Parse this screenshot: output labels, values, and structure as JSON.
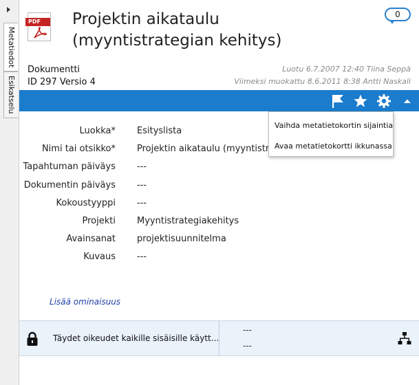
{
  "side_tabs": [
    "Metatiedot",
    "Esikatselu"
  ],
  "header": {
    "file_type": "PDF",
    "title": "Projektin aikataulu (myyntistrategian kehitys)",
    "comment_count": "0",
    "object_type": "Dokumentti",
    "object_id": "ID 297  Versio 4",
    "created": "Luotu 6.7.2007 12:40 Tiina Seppä",
    "modified": "Viimeksi muokattu 8.6.2011 8:38 Antti Naskali"
  },
  "toolbar": {
    "accent": "#1b7ccd",
    "icons": [
      "flag-icon",
      "star-icon",
      "gear-icon",
      "collapse-up-icon"
    ]
  },
  "dropdown": {
    "items": [
      "Vaihda metatietokortin sijaintia",
      "Avaa metatietokortti ikkunassa"
    ]
  },
  "properties": [
    {
      "label": "Luokka*",
      "value": "Esityslista"
    },
    {
      "label": "Nimi tai otsikko*",
      "value": "Projektin aikataulu (myyntistrateg"
    },
    {
      "label": "Tapahtuman päiväys",
      "value": "---"
    },
    {
      "label": "Dokumentin päiväys",
      "value": "---"
    },
    {
      "label": "Kokoustyyppi",
      "value": "---"
    },
    {
      "label": "Projekti",
      "value": "Myyntistrategiakehitys"
    },
    {
      "label": "Avainsanat",
      "value": "projektisuunnitelma"
    },
    {
      "label": "Kuvaus",
      "value": "---"
    }
  ],
  "add_property": "Lisää ominaisuus",
  "permissions": {
    "text": "Täydet oikeudet kaikille sisäisille käytt...",
    "workflow": "---",
    "state": "---"
  }
}
